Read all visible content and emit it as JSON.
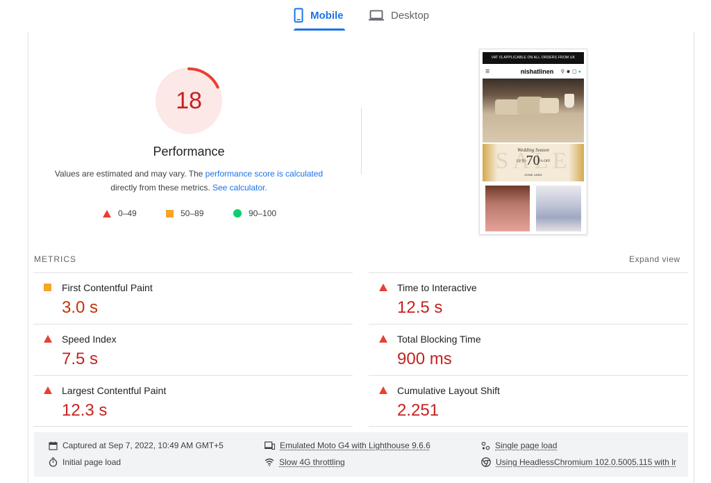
{
  "tabs": {
    "mobile": "Mobile",
    "desktop": "Desktop",
    "active": "Mobile"
  },
  "performance": {
    "score": "18",
    "score_fraction": 0.18,
    "title": "Performance",
    "desc_prefix": "Values are estimated and may vary. The ",
    "desc_link1": "performance score is calculated",
    "desc_middle": "directly from these metrics. ",
    "desc_link2": "See calculator.",
    "legend": [
      {
        "shape": "triangle",
        "range": "0–49",
        "color": "#eb3e32"
      },
      {
        "shape": "square",
        "range": "50–89",
        "color": "#f4a52a"
      },
      {
        "shape": "circle",
        "range": "90–100",
        "color": "#0cce6b"
      }
    ]
  },
  "screenshot": {
    "banner": "VAT IS APPLICABLE ON ALL ORDERS FROM UK",
    "logo": "nishatlinen",
    "sale_heading": "Wedding Season",
    "sale_upto": "UP TO",
    "sale_value": "70",
    "sale_off": "% OFF",
    "sale_bg": "SALE",
    "sale_sub": "HOME LINEN"
  },
  "metrics": {
    "title": "METRICS",
    "expand": "Expand view",
    "items": [
      {
        "label": "First Contentful Paint",
        "value": "3.0 s",
        "status": "average"
      },
      {
        "label": "Time to Interactive",
        "value": "12.5 s",
        "status": "fail"
      },
      {
        "label": "Speed Index",
        "value": "7.5 s",
        "status": "fail"
      },
      {
        "label": "Total Blocking Time",
        "value": "900 ms",
        "status": "fail"
      },
      {
        "label": "Largest Contentful Paint",
        "value": "12.3 s",
        "status": "fail"
      },
      {
        "label": "Cumulative Layout Shift",
        "value": "2.251",
        "status": "fail"
      }
    ]
  },
  "footer": {
    "captured": "Captured at Sep 7, 2022, 10:49 AM GMT+5",
    "initial_load": "Initial page load",
    "emulated": "Emulated Moto G4 with Lighthouse 9.6.6",
    "throttling": "Slow 4G throttling",
    "single_load": "Single page load",
    "browser": "Using HeadlessChromium 102.0.5005.115 with lr"
  },
  "colors": {
    "accent": "#1a73e8",
    "fail": "#c5221f",
    "fail_icon": "#eb3e32",
    "average": "#f4a52a",
    "pass": "#0cce6b",
    "gauge_bg": "#fce8e6"
  }
}
